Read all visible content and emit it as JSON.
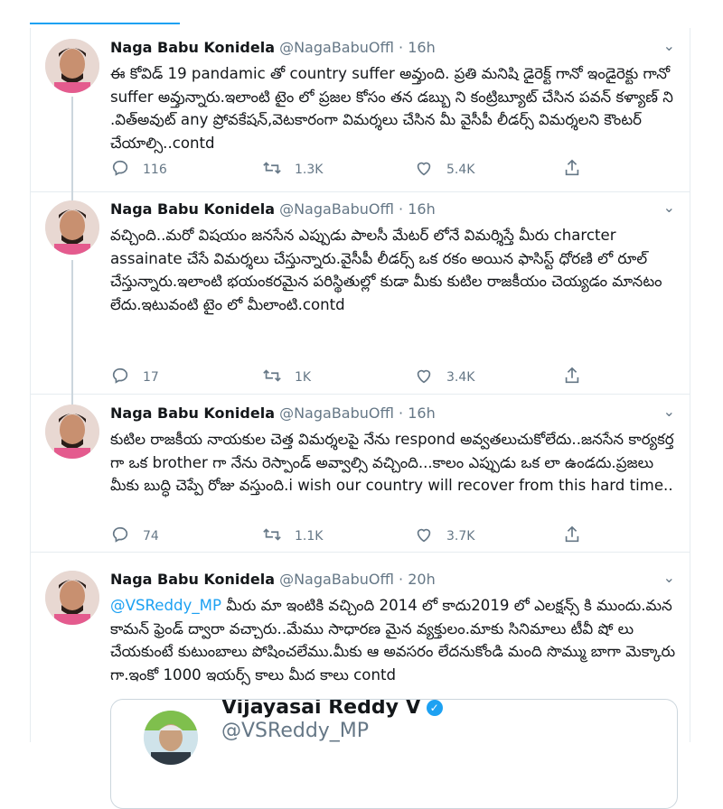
{
  "colors": {
    "accent": "#1da1f2",
    "text": "#14171a",
    "muted": "#657786",
    "border": "#e6ecf0"
  },
  "tweets": [
    {
      "name": "Naga Babu Konidela",
      "handle": "@NagaBabuOffl",
      "time": "· 16h",
      "text": "ఈ కోవిడ్ 19 pandamic తో country suffer అవ్తుంది. ప్రతి మనిషి డైరెక్ట్ గానో ఇండైరెక్టు గానో suffer అవ్తున్నారు.ఇలాంటి టైం లో ప్రజల కోసం తన డబ్బు ని కంట్రిబ్యూట్ చేసిన పవన్ కళ్యాణ్ ని .విత్అవుట్ any ప్రోవకేషన్,వెటకారంగా విమర్శలు చేసిన మీ వైసీపీ లీడర్స్ విమర్శలని కౌంటర్ చేయాల్సి..contd",
      "replies": "116",
      "retweets": "1.3K",
      "likes": "5.4K"
    },
    {
      "name": "Naga Babu Konidela",
      "handle": "@NagaBabuOffl",
      "time": "· 16h",
      "text": "వచ్చింది..మరో విషయం జనసేన ఎప్పుడు పాలసీ మేటర్ లోనే విమర్శిస్తే మీరు charcter assainate చేసే విమర్శలు చేస్తున్నారు.వైసీపీ లీడర్స్ ఒక రకం అయిన ఫాసిస్ట్ ధోరణి లో రూల్ చేస్తున్నారు.ఇలాంటి భయంకరమైన పరిస్థితుల్లో కుడా మీకు కుటిల రాజకీయం చెయ్యడం మానటం లేదు.ఇటువంటి టైం లో మీలాంటి.contd",
      "replies": "17",
      "retweets": "1K",
      "likes": "3.4K"
    },
    {
      "name": "Naga Babu Konidela",
      "handle": "@NagaBabuOffl",
      "time": "· 16h",
      "text": "కుటిల రాజకీయ నాయకుల చెత్త విమర్శలపై నేను respond అవ్వతలుచుకోలేదు..జనసేన కార్యకర్త గా ఒక brother గా నేను రెస్పాండ్ అవ్వాల్సి వచ్చింది...కాలం ఎప్పుడు ఒక లా ఉండదు.ప్రజలు మీకు బుద్ధి చెప్పే రోజు వస్తుంది.i wish our country will recover from this hard time..",
      "replies": "74",
      "retweets": "1.1K",
      "likes": "3.7K"
    },
    {
      "name": "Naga Babu Konidela",
      "handle": "@NagaBabuOffl",
      "time": "· 20h",
      "mention": "@VSReddy_MP",
      "text": " మీరు మా ఇంటికి వచ్చింది 2014 లో కాదు2019 లో ఎలక్షన్స్ కి ముందు.మన కామన్ ఫ్రెండ్ ద్వారా వచ్చారు..మేము సాధారణ మైన వ్యక్తులం.మాకు సినిమాలు టీవీ షో లు చేయకుంటే కుటుంబాలు పోషించలేము.మీకు ఆ అవసరం లేదనుకోండి మంది సొమ్ము బాగా మెక్కారు గా.ఇంకో 1000 ఇయర్స్ కాలు మీద కాలు contd",
      "quote": {
        "name": "Vijayasai Reddy V",
        "handle": "@VSReddy_MP"
      }
    }
  ]
}
